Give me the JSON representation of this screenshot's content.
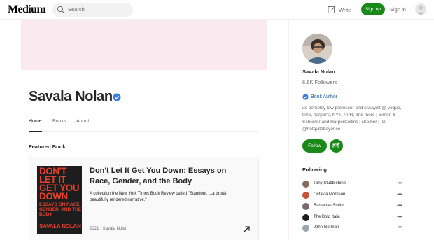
{
  "header": {
    "logo": "Medium",
    "search_placeholder": "Search",
    "write_label": "Write",
    "signup_label": "Sign up",
    "signin_label": "Sign in"
  },
  "profile": {
    "name": "Savala Nolan",
    "tabs": [
      "Home",
      "Books",
      "About"
    ],
    "active_tab": "Home"
  },
  "featured": {
    "section_label": "Featured Book",
    "cover_text_title": "DON'T LET IT GET YOU DOWN",
    "cover_text_subtitle": "ESSAYS ON RACE, GENDER, AND THE BODY",
    "cover_text_author": "SAVALA NOLAN",
    "title": "Don't Let It Get You Down: Essays on Race, Gender, and the Body",
    "description": "A collection the New York Times Book Review called \"Standout. ...a brutal, beautifully rendered narrative.\"",
    "meta": "2021 · Savala Nolan"
  },
  "sidebar": {
    "name": "Savala Nolan",
    "followers": "6.6K Followers",
    "author_badge": "Book Author",
    "bio": "uc berkeley law professor and essayist @ vogue, time, harper's, NYT, NPR, and more | Simon & Schuster and HarperCollins | she/her | IG @notquitebeyonce",
    "follow_label": "Follow",
    "following_title": "Following",
    "following": [
      {
        "name": "Tony Stubblebine",
        "color": "#8a6d5a"
      },
      {
        "name": "Octavia Morrison",
        "color": "#c4533a"
      },
      {
        "name": "Barnabas Smith",
        "color": "#7a6a6a"
      },
      {
        "name": "The Bold Italic",
        "color": "#1d1d1d"
      },
      {
        "name": "John Gorman",
        "color": "#9aa6b0"
      }
    ]
  },
  "colors": {
    "brand_green": "#1a8917",
    "banner_pink": "#fbe9f0",
    "badge_blue": "#1a5ea8"
  }
}
